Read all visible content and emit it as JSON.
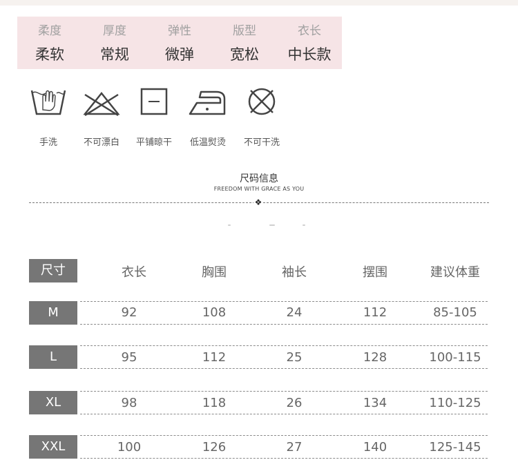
{
  "properties": [
    {
      "label": "柔度",
      "value": "柔软"
    },
    {
      "label": "厚度",
      "value": "常规"
    },
    {
      "label": "弹性",
      "value": "微弹"
    },
    {
      "label": "版型",
      "value": "宽松"
    },
    {
      "label": "衣长",
      "value": "中长款"
    }
  ],
  "care": [
    {
      "icon": "hand-wash-icon",
      "label": "手洗"
    },
    {
      "icon": "no-bleach-icon",
      "label": "不可漂白"
    },
    {
      "icon": "dry-flat-icon",
      "label": "平铺晾干"
    },
    {
      "icon": "low-iron-icon",
      "label": "低温熨烫"
    },
    {
      "icon": "no-dry-clean-icon",
      "label": "不可干洗"
    }
  ],
  "size_section": {
    "title": "尺码信息",
    "subtitle": "FREEDOM WITH GRACE AS YOU"
  },
  "size_chart": {
    "header": {
      "tag": "尺寸",
      "columns": [
        "衣长",
        "胸围",
        "袖长",
        "摆围",
        "建议体重"
      ]
    },
    "rows": [
      {
        "size": "M",
        "values": [
          "92",
          "108",
          "24",
          "112",
          "85-105"
        ]
      },
      {
        "size": "L",
        "values": [
          "95",
          "112",
          "25",
          "128",
          "100-115"
        ]
      },
      {
        "size": "XL",
        "values": [
          "98",
          "118",
          "26",
          "134",
          "110-125"
        ]
      },
      {
        "size": "XXL",
        "values": [
          "100",
          "126",
          "27",
          "140",
          "125-145"
        ]
      }
    ]
  }
}
